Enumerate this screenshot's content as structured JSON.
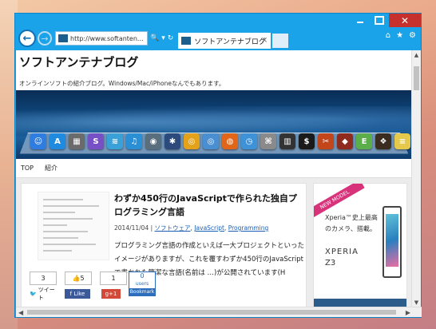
{
  "window": {
    "address": "http://www.softanten...",
    "tab_title": "ソフトアンテナブログ",
    "tab_close": "×",
    "back_label": "←",
    "forward_label": "→",
    "search_glyph": "🔍",
    "dropdown_glyph": "▾",
    "refresh_glyph": "↻",
    "caption": {
      "minimize": "",
      "maximize": "",
      "close": "✕"
    },
    "toolbar_icons": {
      "home": "⌂",
      "favorites": "★",
      "settings": "⚙"
    }
  },
  "site": {
    "title": "ソフトアンテナブログ",
    "description": "オンラインソフトの紹介ブログ。Windows/Mac/iPhoneなんでもあります。"
  },
  "nav": {
    "items": [
      "TOP",
      "紹介"
    ]
  },
  "dock_icons": [
    {
      "name": "finder-icon",
      "color": "#2f7de1",
      "glyph": "☺"
    },
    {
      "name": "appstore-icon",
      "color": "#1f8be0",
      "glyph": "A"
    },
    {
      "name": "terminal-icon",
      "color": "#6b6b6b",
      "glyph": "▦"
    },
    {
      "name": "app-icon",
      "color": "#7750c6",
      "glyph": "S"
    },
    {
      "name": "app-icon",
      "color": "#3aa0d8",
      "glyph": "≋"
    },
    {
      "name": "itunes-icon",
      "color": "#2b8fd6",
      "glyph": "♫"
    },
    {
      "name": "app-icon",
      "color": "#5a6f7e",
      "glyph": "◉"
    },
    {
      "name": "app-icon",
      "color": "#2c4a7c",
      "glyph": "✱"
    },
    {
      "name": "chrome-icon",
      "color": "#e3a21a",
      "glyph": "◎"
    },
    {
      "name": "chromium-icon",
      "color": "#4a8fd1",
      "glyph": "◎"
    },
    {
      "name": "firefox-icon",
      "color": "#e2661a",
      "glyph": "◍"
    },
    {
      "name": "safari-icon",
      "color": "#3d92d8",
      "glyph": "◷"
    },
    {
      "name": "app-icon",
      "color": "#8a8a8a",
      "glyph": "⌘"
    },
    {
      "name": "app-icon",
      "color": "#333333",
      "glyph": "▥"
    },
    {
      "name": "terminal-icon",
      "color": "#1a1a1a",
      "glyph": "$"
    },
    {
      "name": "app-icon",
      "color": "#c3461b",
      "glyph": "✂"
    },
    {
      "name": "app-icon",
      "color": "#8e2a1e",
      "glyph": "◆"
    },
    {
      "name": "evernote-icon",
      "color": "#5cae4a",
      "glyph": "E"
    },
    {
      "name": "app-icon",
      "color": "#3a2c1e",
      "glyph": "❖"
    },
    {
      "name": "notes-icon",
      "color": "#e6c84a",
      "glyph": "≡"
    },
    {
      "name": "app-icon",
      "color": "#d5d5d5",
      "glyph": "◇"
    }
  ],
  "article": {
    "title": "わずか450行のJavaScriptで作られた独自プログラミング言語",
    "date": "2014/11/04",
    "separator": "|",
    "categories": [
      "ソフトウェア",
      "JavaScript",
      "Programming"
    ],
    "body": "プログラミング言語の作成といえば一大プロジェクトといったイメージがありますが、これを覆すわずか450行のJavaScriptで書かれた簡潔な言語(名前は …)が公開されています(H"
  },
  "share": {
    "tweet_count": "3",
    "tweet_label": "ツイート",
    "like_count": "5",
    "like_label": "Like",
    "gplus_count": "1",
    "gplus_label": "g+1",
    "hatena_count": "0",
    "hatena_users": "users",
    "hatena_label": "Bookmark"
  },
  "ad": {
    "ribbon": "NEW MODEL",
    "copy": "Xperia™史上最高のカメラ、搭載。",
    "brand": "XPERIA",
    "model": "Z3"
  },
  "colors": {
    "window_frame": "#1aa3e8",
    "close_button": "#c7312d",
    "link": "#1a5fb4",
    "facebook": "#3b5998",
    "google_plus": "#d34836",
    "hatena": "#2c6ebd",
    "ad_ribbon": "#d8327a"
  }
}
